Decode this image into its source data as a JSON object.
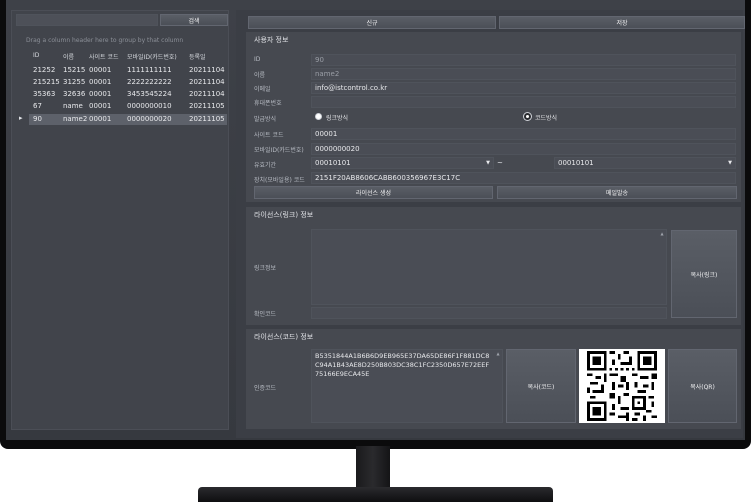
{
  "left_panel": {
    "search_button": "검색",
    "group_hint": "Drag a column header here to group by that column",
    "columns": [
      "ID",
      "이름",
      "사이트 코드",
      "모바일ID(카드번호)",
      "등록일"
    ],
    "rows": [
      [
        "21252",
        "15215",
        "00001",
        "1111111111",
        "20211104"
      ],
      [
        "215215",
        "31255",
        "00001",
        "2222222222",
        "20211104"
      ],
      [
        "35363",
        "32636",
        "00001",
        "3453545224",
        "20211104"
      ],
      [
        "67",
        "name",
        "00001",
        "0000000010",
        "20211105"
      ],
      [
        "90",
        "name2",
        "00001",
        "0000000020",
        "20211105"
      ]
    ],
    "current_row_indicator": "▸"
  },
  "toolbar": {
    "new_label": "신규",
    "save_label": "저장"
  },
  "user_info": {
    "section_title": "사용자 정보",
    "labels": {
      "id": "ID",
      "name": "이름",
      "email": "이메일",
      "phone": "휴대폰번호",
      "issue_method": "발급방식",
      "site_code": "사이트 코드",
      "mobile_id": "모바일ID(카드번호)",
      "validity": "유효기간",
      "device": "장치(모바일용) 코드"
    },
    "values": {
      "id": "90",
      "name": "name2",
      "email": "info@istcontrol.co.kr",
      "phone": "",
      "site_code": "00001",
      "mobile_id": "0000000020",
      "valid_from": "00010101",
      "valid_to": "00010101",
      "range_sep": "~",
      "device": "2151F20AB8606CABB600356967E3C17C"
    },
    "radio_link": "링크방식",
    "radio_code": "코드방식",
    "selected_method": "code",
    "generate_button": "라이선스 생성",
    "email_button": "메일발송"
  },
  "license_link": {
    "section_title": "라이선스(링크) 정보",
    "link_label": "링크정보",
    "confirm_label": "확인코드",
    "link_value": "",
    "confirm_value": "",
    "copy_button": "복사(링크)"
  },
  "license_code": {
    "section_title": "라이선스(코드) 정보",
    "auth_label": "인증코드",
    "auth_value": "B5351844A1B6B6D9EB965E37DA65DE86F1F881DC8C94A1B43AE8D250B803DC38C1FC2350D657E72EEF75166E9ECA45E",
    "copy_code_button": "복사(코드)",
    "copy_qr_button": "복사(QR)"
  },
  "colors": {
    "accent_selected_row": "#5d616a",
    "panel_bg": "#3e4148"
  }
}
